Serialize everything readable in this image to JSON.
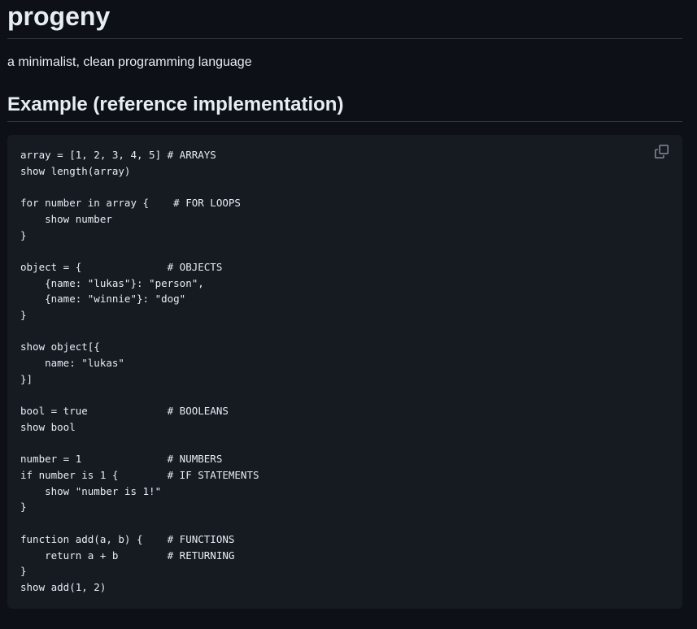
{
  "page": {
    "title": "progeny",
    "description": "a minimalist, clean programming language",
    "section_heading": "Example (reference implementation)"
  },
  "code_block": {
    "language": "progeny",
    "copy_icon": "copy-icon",
    "lines": [
      "array = [1, 2, 3, 4, 5] # ARRAYS",
      "show length(array)",
      "",
      "for number in array {    # FOR LOOPS",
      "    show number",
      "}",
      "",
      "object = {              # OBJECTS",
      "    {name: \"lukas\"}: \"person\",",
      "    {name: \"winnie\"}: \"dog\"",
      "}",
      "",
      "show object[{",
      "    name: \"lukas\"",
      "}]",
      "",
      "bool = true             # BOOLEANS",
      "show bool",
      "",
      "number = 1              # NUMBERS",
      "if number is 1 {        # IF STATEMENTS",
      "    show \"number is 1!\"",
      "}",
      "",
      "function add(a, b) {    # FUNCTIONS",
      "    return a + b        # RETURNING",
      "}",
      "show add(1, 2)"
    ]
  },
  "colors": {
    "background": "#0d1117",
    "code_background": "#161b22",
    "text": "#e6edf3",
    "divider": "#30363d",
    "icon": "#7d8590"
  }
}
